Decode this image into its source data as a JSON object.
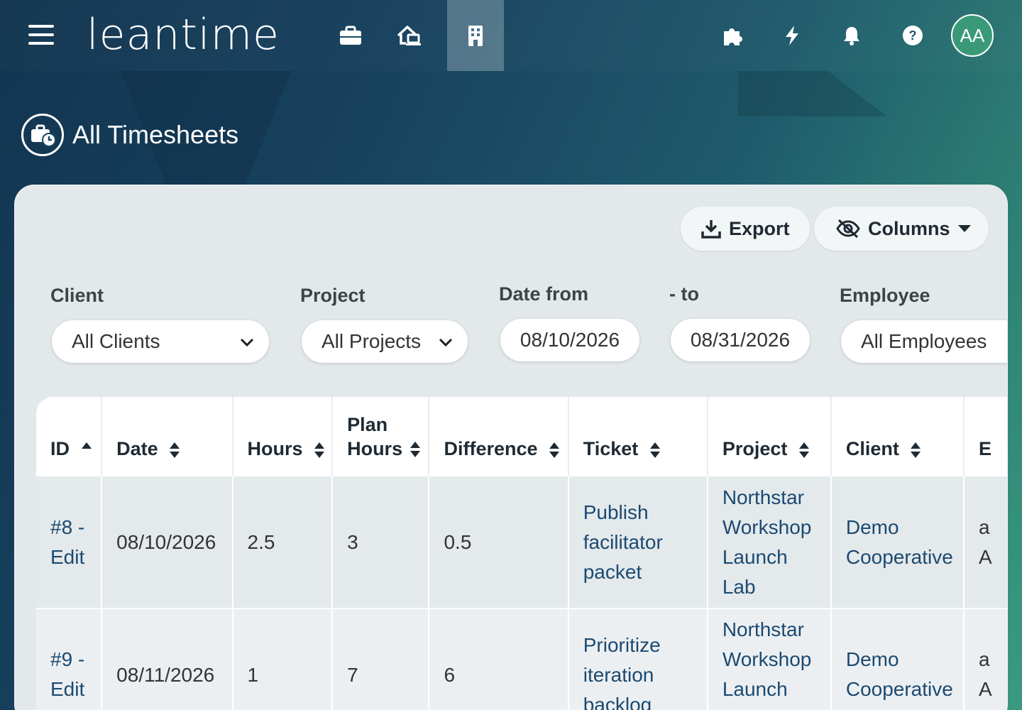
{
  "app": {
    "logo": "leantime",
    "avatar_initials": "AA"
  },
  "nav": {
    "icons": [
      "menu-icon",
      "briefcase-icon",
      "home-devices-icon",
      "building-icon"
    ],
    "right_icons": [
      "puzzle-icon",
      "bolt-icon",
      "bell-icon",
      "help-icon"
    ]
  },
  "page": {
    "title": "All Timesheets"
  },
  "toolbar": {
    "export_label": "Export",
    "columns_label": "Columns"
  },
  "filters": {
    "client_label": "Client",
    "client_value": "All Clients",
    "project_label": "Project",
    "project_value": "All Projects",
    "date_from_label": "Date from",
    "date_from_value": "08/10/2026",
    "date_to_label": "- to",
    "date_to_value": "08/31/2026",
    "employee_label": "Employee",
    "employee_value": "All Employees"
  },
  "table": {
    "headers": [
      "ID",
      "Date",
      "Hours",
      "Plan Hours",
      "Difference",
      "Ticket",
      "Project",
      "Client",
      "E"
    ],
    "rows": [
      {
        "id": "#8 - Edit",
        "date": "08/10/2026",
        "hours": "2.5",
        "plan_hours": "3",
        "difference": "0.5",
        "ticket": "Publish facilitator packet",
        "project": "Northstar Workshop Launch Lab",
        "client": "Demo Cooperative",
        "employee": "a A"
      },
      {
        "id": "#9 - Edit",
        "date": "08/11/2026",
        "hours": "1",
        "plan_hours": "7",
        "difference": "6",
        "ticket": "Prioritize iteration backlog",
        "project": "Northstar Workshop Launch",
        "client": "Demo Cooperative",
        "employee": "a A"
      }
    ]
  },
  "colors": {
    "accent": "#3a9a78",
    "link": "#1b4a72",
    "card_bg": "#e3e8ea"
  }
}
